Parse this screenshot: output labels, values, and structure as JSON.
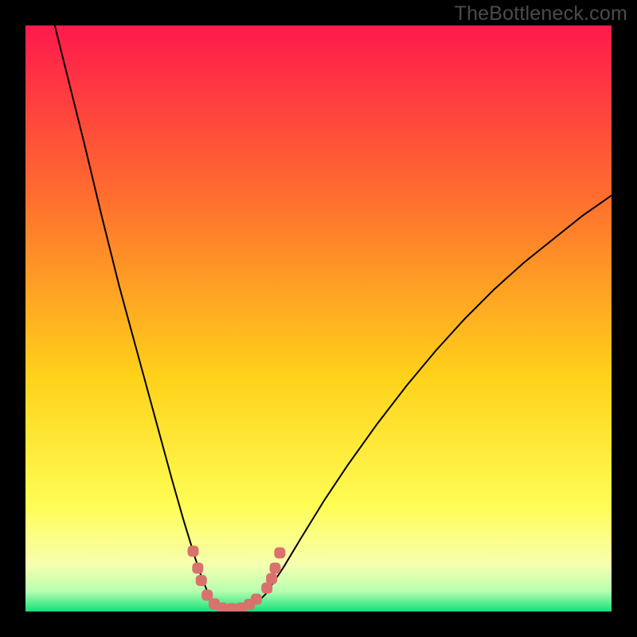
{
  "watermark": "TheBottleneck.com",
  "colors": {
    "gradient_top": "#ff1a4c",
    "gradient_mid1": "#ff6a2f",
    "gradient_mid2": "#ffd21a",
    "gradient_mid3": "#fffd55",
    "gradient_bottom_band": "#f6ffb0",
    "gradient_bottom": "#14e07a",
    "curve": "#000000",
    "marker": "#d9716c",
    "frame": "#000000"
  },
  "chart_data": {
    "type": "line",
    "title": "",
    "xlabel": "",
    "ylabel": "",
    "xlim": [
      0,
      100
    ],
    "ylim": [
      0,
      100
    ],
    "curve_comment": "V-shaped bottleneck curve. Left branch steep, right branch shallower. Minimum near x≈33, y≈0.",
    "curve": [
      {
        "x": 5.0,
        "y": 100.0
      },
      {
        "x": 7.0,
        "y": 92.0
      },
      {
        "x": 10.0,
        "y": 80.0
      },
      {
        "x": 13.0,
        "y": 67.5
      },
      {
        "x": 16.0,
        "y": 55.5
      },
      {
        "x": 19.0,
        "y": 44.5
      },
      {
        "x": 22.0,
        "y": 33.5
      },
      {
        "x": 25.0,
        "y": 22.5
      },
      {
        "x": 27.0,
        "y": 15.5
      },
      {
        "x": 29.0,
        "y": 9.0
      },
      {
        "x": 30.0,
        "y": 6.0
      },
      {
        "x": 31.0,
        "y": 3.5
      },
      {
        "x": 32.0,
        "y": 1.8
      },
      {
        "x": 33.0,
        "y": 0.8
      },
      {
        "x": 34.0,
        "y": 0.4
      },
      {
        "x": 36.0,
        "y": 0.4
      },
      {
        "x": 38.0,
        "y": 0.9
      },
      {
        "x": 40.0,
        "y": 2.0
      },
      {
        "x": 41.0,
        "y": 3.0
      },
      {
        "x": 42.0,
        "y": 4.5
      },
      {
        "x": 44.0,
        "y": 7.5
      },
      {
        "x": 47.0,
        "y": 12.5
      },
      {
        "x": 51.0,
        "y": 19.0
      },
      {
        "x": 55.0,
        "y": 25.0
      },
      {
        "x": 60.0,
        "y": 32.0
      },
      {
        "x": 65.0,
        "y": 38.5
      },
      {
        "x": 70.0,
        "y": 44.5
      },
      {
        "x": 75.0,
        "y": 50.0
      },
      {
        "x": 80.0,
        "y": 55.0
      },
      {
        "x": 85.0,
        "y": 59.5
      },
      {
        "x": 90.0,
        "y": 63.5
      },
      {
        "x": 95.0,
        "y": 67.5
      },
      {
        "x": 100.0,
        "y": 71.0
      }
    ],
    "markers_comment": "rounded pink segment markers near the valley floor and at the sharp turn regions",
    "markers": [
      {
        "x": 28.6,
        "y": 10.3
      },
      {
        "x": 29.4,
        "y": 7.4
      },
      {
        "x": 30.0,
        "y": 5.3
      },
      {
        "x": 31.0,
        "y": 2.8
      },
      {
        "x": 32.2,
        "y": 1.3
      },
      {
        "x": 33.6,
        "y": 0.6
      },
      {
        "x": 35.2,
        "y": 0.5
      },
      {
        "x": 36.8,
        "y": 0.6
      },
      {
        "x": 38.2,
        "y": 1.2
      },
      {
        "x": 39.4,
        "y": 2.1
      },
      {
        "x": 41.2,
        "y": 4.0
      },
      {
        "x": 42.0,
        "y": 5.6
      },
      {
        "x": 42.6,
        "y": 7.4
      },
      {
        "x": 43.4,
        "y": 10.0
      }
    ]
  }
}
